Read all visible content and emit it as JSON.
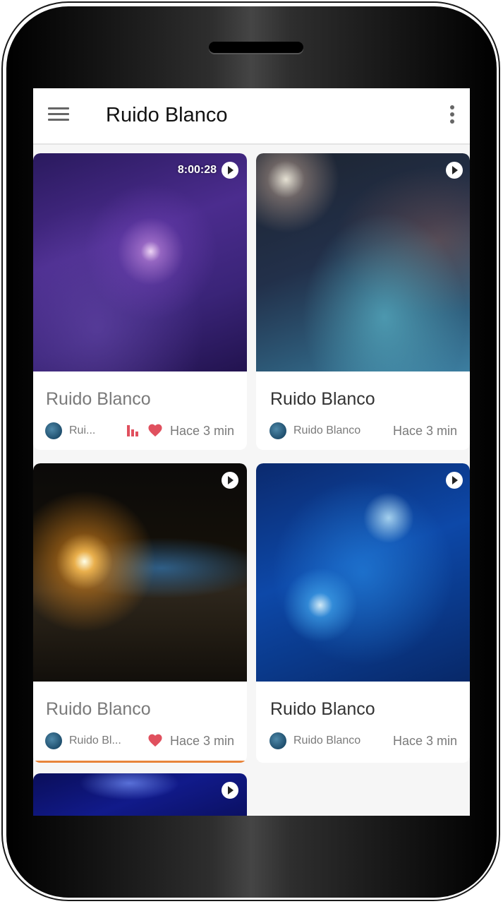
{
  "appbar": {
    "title": "Ruido Blanco",
    "menu_icon": "hamburger-menu-icon",
    "more_icon": "more-vertical-icon"
  },
  "cards": [
    {
      "title": "Ruido Blanco",
      "title_color": "#7a7a7a",
      "author": "Rui...",
      "time": "Hace 3 min",
      "duration": "8:00:28",
      "liked": true,
      "playing": true,
      "image": "purple-galaxy"
    },
    {
      "title": "Ruido Blanco",
      "title_color": "#333333",
      "author": "Ruido Blanco",
      "time": "Hace 3 min",
      "image": "nebula"
    },
    {
      "title": "Ruido Blanco",
      "title_color": "#7a7a7a",
      "author": "Ruido Bl...",
      "time": "Hace 3 min",
      "liked": true,
      "progress": 0.99,
      "image": "earth-sunrise"
    },
    {
      "title": "Ruido Blanco",
      "title_color": "#333333",
      "author": "Ruido Blanco",
      "time": "Hace 3 min",
      "image": "digital-brain"
    },
    {
      "image": "neural-network"
    }
  ],
  "colors": {
    "accent_heart": "#e0505e",
    "progress": "#e8843a"
  }
}
